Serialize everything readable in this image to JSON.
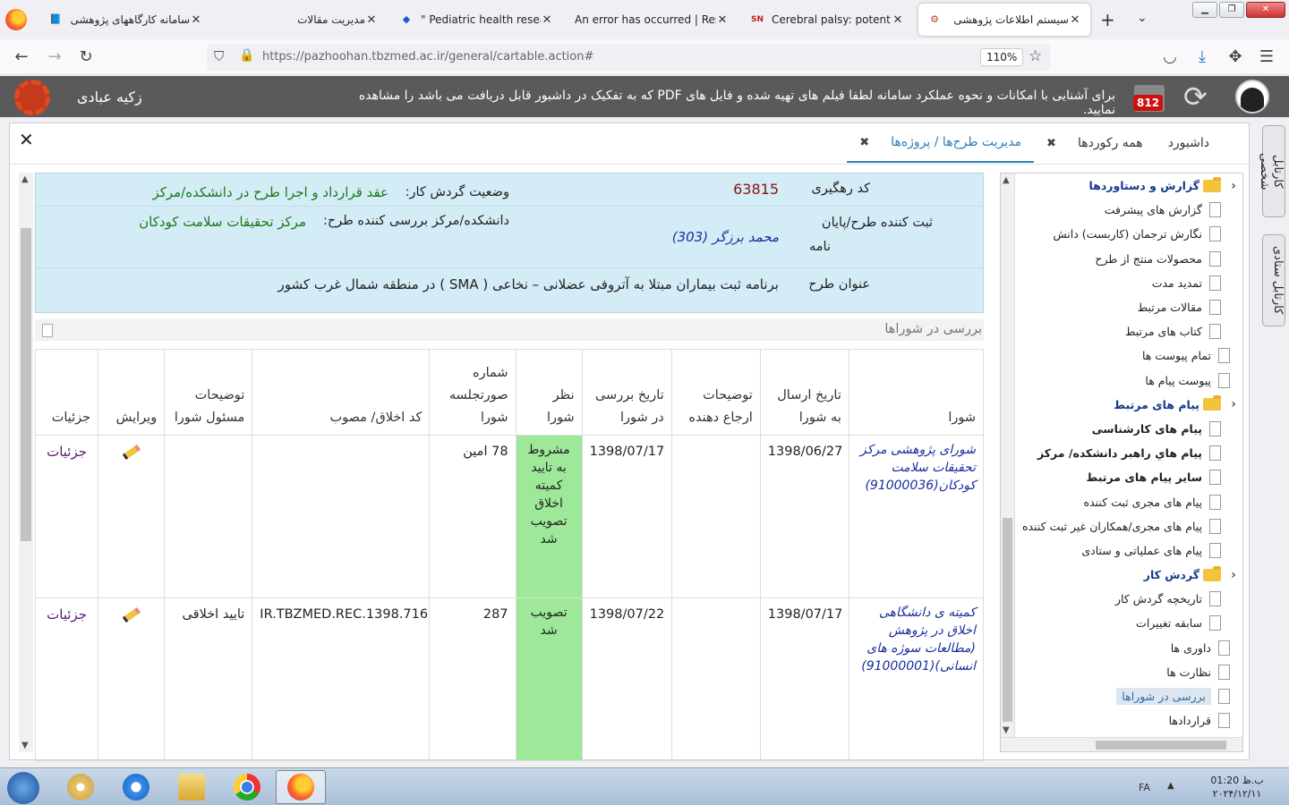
{
  "browser": {
    "tabs": [
      {
        "title": "سامانه کارگاههای پژوهشی",
        "icon": "book-icon"
      },
      {
        "title": "مدیریت مقالات",
        "icon": "none"
      },
      {
        "title": "\" Pediatric health research",
        "icon": "diamond-icon"
      },
      {
        "title": "An error has occurred | Resear",
        "icon": "none"
      },
      {
        "title": "Cerebral palsy: potential r",
        "icon": "sn-icon"
      },
      {
        "title": "سیستم اطلاعات پژوهشی",
        "icon": "gear-icon"
      }
    ],
    "url": "https://pazhoohan.tbzmed.ac.ir/general/cartable.action#",
    "zoom": "110%"
  },
  "header": {
    "user_name": "زکیه عبادی",
    "notice": "برای آشنایی با امکانات و نحوه عملکرد سامانه لطفا فیلم های تهیه شده و فایل های PDF که به تفکیک در داشبور قابل دریافت می باشد را مشاهده نمایید.",
    "badge_count": "812"
  },
  "page_tabs": [
    {
      "label": "داشبورد"
    },
    {
      "label": "همه رکوردها"
    },
    {
      "label": "مدیریت طرح‌ها / پروژه‌ها"
    }
  ],
  "side_tabs": {
    "personal": "کارتابل شخصی",
    "staff": "کارتابل ستادی"
  },
  "info": {
    "tracking_code_label": "کد رهگیری",
    "tracking_code": "63815",
    "workflow_status_label": "وضعیت گردش کار:",
    "workflow_status": "عقد قرارداد و اجرا طرح در دانشکده/مرکز",
    "registrar_label_1": "ثبت کننده طرح/پایان",
    "registrar_label_2": "نامه",
    "registrar": "محمد برزگر (303)",
    "reviewer_label": "دانشکده/مرکز بررسی کننده طرح:",
    "reviewer": "مرکز تحقیقات سلامت کودکان",
    "title_label": "عنوان طرح",
    "title": "برنامه ثبت بیماران مبتلا به  آتروفی عضلانی – نخاعی  ( SMA ) در منطقه شمال غرب کشور"
  },
  "section": {
    "title": "بررسی در شوراها"
  },
  "table": {
    "headers": {
      "council": "شورا",
      "send_date": "تاریخ ارسال به شورا",
      "referrer_notes": "توضیحات ارجاع دهنده",
      "review_date": "تاریخ بررسی در شورا",
      "opinion": "نظر شورا",
      "minutes_no": "شماره صورتجلسه شورا",
      "ethics_code": "کد اخلاق/ مصوب",
      "officer_notes": "توضیحات مسئول شورا",
      "edit": "ویرایش",
      "details": "جزئیات"
    },
    "rows": [
      {
        "council": "شورای پژوهشی مرکز تحقیقات سلامت کودکان(91000036)",
        "send_date": "1398/06/27",
        "referrer_notes": "",
        "review_date": "1398/07/17",
        "opinion": "مشروط به تایید کمیته اخلاق تصویب شد",
        "minutes_no": "78 امین",
        "ethics_code": "",
        "officer_notes": "",
        "details": "جزئیات"
      },
      {
        "council": "کمیته ی دانشگاهی اخلاق در پژوهش (مطالعات سوژه های انسانی)(91000001)",
        "send_date": "1398/07/17",
        "referrer_notes": "",
        "review_date": "1398/07/22",
        "opinion": "تصویب شد",
        "minutes_no": "287",
        "ethics_code": "IR.TBZMED.REC.1398.716",
        "officer_notes": "تایید اخلاقی",
        "details": "جزئیات"
      }
    ],
    "opinion_color": "#9ee89a"
  },
  "tree": {
    "items": [
      {
        "label": "گزارش و دستاوردها",
        "type": "folder"
      },
      {
        "label": "گزارش های پیشرفت",
        "type": "page"
      },
      {
        "label": "نگارش ترجمان (کاربست) دانش",
        "type": "page"
      },
      {
        "label": "محصولات منتج از طرح",
        "type": "page"
      },
      {
        "label": "تمدید مدت",
        "type": "page"
      },
      {
        "label": "مقالات مرتبط",
        "type": "page"
      },
      {
        "label": "کتاب های مرتبط",
        "type": "page"
      },
      {
        "label": "تمام پیوست ها",
        "type": "page2"
      },
      {
        "label": "پیوست پیام ها",
        "type": "page2"
      },
      {
        "label": "پیام های مرتبط",
        "type": "folder"
      },
      {
        "label": "پیام های کارشناسی",
        "type": "bold"
      },
      {
        "label": "پیام هاي راهبر دانشکده/ مرکز",
        "type": "bold"
      },
      {
        "label": "سایر پیام های مرتبط",
        "type": "bold"
      },
      {
        "label": "پیام های مجری ثبت کننده",
        "type": "page"
      },
      {
        "label": "پیام های مجری/همکاران غیر ثبت کننده",
        "type": "page"
      },
      {
        "label": "پیام های عملیاتی و ستادی",
        "type": "page"
      },
      {
        "label": "گردش کار",
        "type": "folder"
      },
      {
        "label": "تاریخچه گردش کار",
        "type": "page"
      },
      {
        "label": "سابقه تغییرات",
        "type": "page"
      },
      {
        "label": "داوری ها",
        "type": "page2"
      },
      {
        "label": "نظارت ها",
        "type": "page2"
      },
      {
        "label": "بررسی در شوراها",
        "type": "selected"
      },
      {
        "label": "قراردادها",
        "type": "page2"
      }
    ]
  },
  "taskbar": {
    "lang": "FA",
    "time": "ب.ظ 01:20",
    "date": "۲۰۲۴/۱۲/۱۱"
  }
}
